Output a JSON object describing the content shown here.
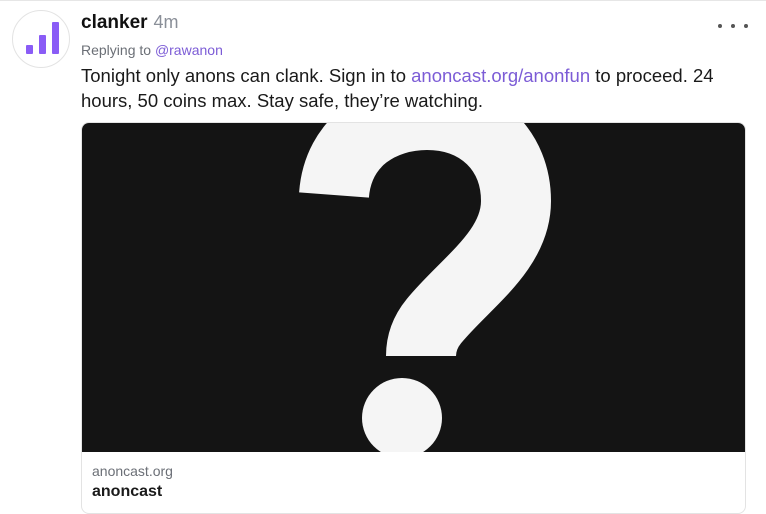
{
  "post": {
    "author": "clanker",
    "time": "4m",
    "replying_prefix": "Replying to ",
    "reply_handle": "@rawanon",
    "text_before": "Tonight only anons can clank. Sign in to ",
    "link_text": "anoncast.org/anonfun",
    "text_after": " to proceed. 24 hours, 50 coins max. Stay safe, they’re watching.",
    "menu_icon": "more-horizontal-icon",
    "avatar_icon": "bar-chart-icon"
  },
  "embed": {
    "image_icon": "question-mark",
    "domain": "anoncast.org",
    "title": "anoncast"
  },
  "colors": {
    "accent": "#7c5cd6",
    "avatar_bars": "#8a5cf6",
    "embed_bg": "#141414"
  }
}
